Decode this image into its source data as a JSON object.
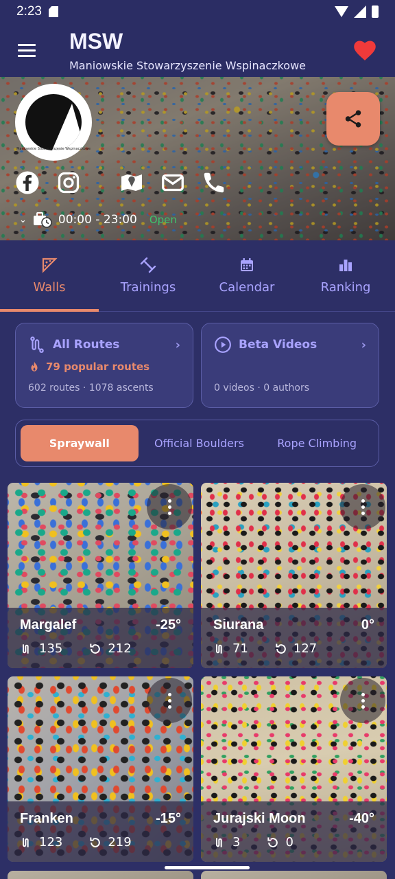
{
  "status_bar": {
    "time": "2:23"
  },
  "header": {
    "title": "MSW",
    "subtitle": "Maniowskie Stowarzyszenie Wspinaczkowe"
  },
  "hero": {
    "logo_text": "Maniowskie Stowarzyszenie Wspinaczkowe",
    "hours": "00:00 - 23:00",
    "open_status": "Open",
    "contact_icons": [
      "facebook-icon",
      "instagram-icon",
      "map-icon",
      "email-icon",
      "phone-icon"
    ]
  },
  "tabs": [
    {
      "label": "Walls",
      "icon": "walls-icon",
      "active": true
    },
    {
      "label": "Trainings",
      "icon": "dumbbell-icon",
      "active": false
    },
    {
      "label": "Calendar",
      "icon": "calendar-icon",
      "active": false
    },
    {
      "label": "Ranking",
      "icon": "bar-chart-icon",
      "active": false
    }
  ],
  "cards": {
    "routes": {
      "title": "All Routes",
      "popular": "79 popular routes",
      "meta": "602 routes · 1078 ascents"
    },
    "videos": {
      "title": "Beta Videos",
      "meta": "0 videos · 0 authors"
    }
  },
  "segments": [
    {
      "label": "Spraywall",
      "active": true
    },
    {
      "label": "Official Boulders",
      "active": false
    },
    {
      "label": "Rope Climbing",
      "active": false
    }
  ],
  "walls": [
    {
      "name": "Margalef",
      "angle": "-25°",
      "routes": "135",
      "ascents": "212"
    },
    {
      "name": "Siurana",
      "angle": "0°",
      "routes": "71",
      "ascents": "127"
    },
    {
      "name": "Franken",
      "angle": "-15°",
      "routes": "123",
      "ascents": "219"
    },
    {
      "name": "Jurajski Moon",
      "angle": "-40°",
      "routes": "3",
      "ascents": "0"
    }
  ],
  "colors": {
    "background": "#2d2f66",
    "accent": "#e8896c",
    "tab_inactive": "#a9a3ff",
    "open_green": "#3ec46d",
    "favorite_red": "#f03a3a"
  }
}
